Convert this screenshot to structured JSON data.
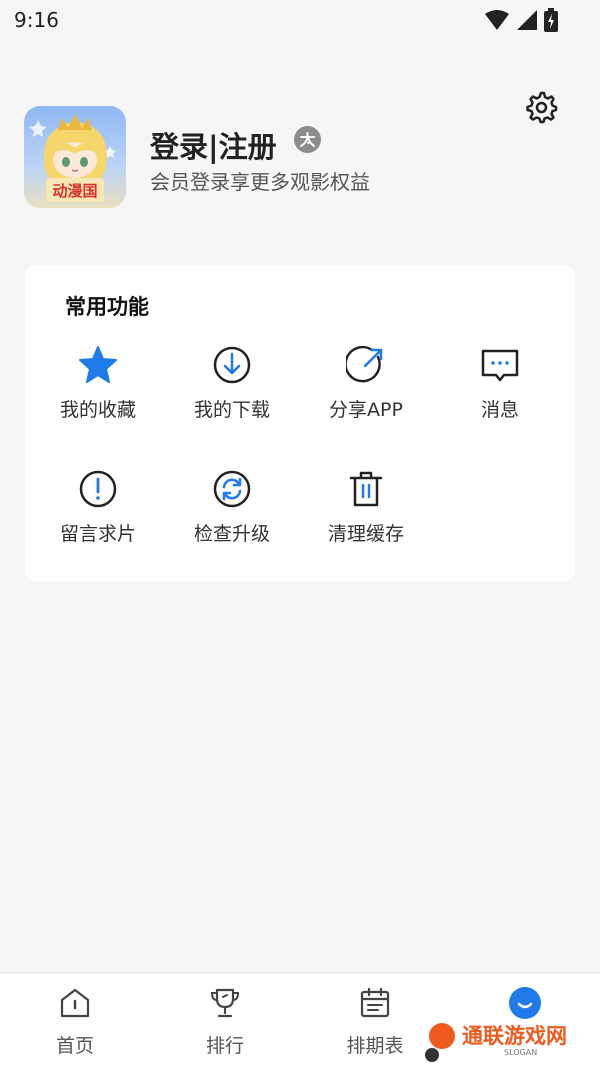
{
  "status_bar": {
    "time": "9:16",
    "icons": [
      "wifi-icon",
      "signal-icon",
      "battery-icon"
    ]
  },
  "profile": {
    "title": "登录|注册",
    "subtitle": "会员登录享更多观影权益",
    "avatar_text": "动漫国",
    "badge_icon": "vip-badge-icon",
    "settings_icon": "gear-icon"
  },
  "functions": {
    "title": "常用功能",
    "items": [
      {
        "label": "我的收藏",
        "icon": "star-icon"
      },
      {
        "label": "我的下载",
        "icon": "download-icon"
      },
      {
        "label": "分享APP",
        "icon": "share-icon"
      },
      {
        "label": "消息",
        "icon": "message-icon"
      },
      {
        "label": "留言求片",
        "icon": "exclamation-icon"
      },
      {
        "label": "检查升级",
        "icon": "refresh-icon"
      },
      {
        "label": "清理缓存",
        "icon": "trash-icon"
      }
    ]
  },
  "bottom_nav": {
    "items": [
      {
        "label": "首页",
        "icon": "home-icon"
      },
      {
        "label": "排行",
        "icon": "trophy-icon"
      },
      {
        "label": "排期表",
        "icon": "calendar-icon"
      },
      {
        "label": "",
        "icon": "profile-icon"
      }
    ]
  },
  "watermark": {
    "text": "通联游戏网",
    "sub": "SLOGAN"
  },
  "colors": {
    "accent": "#1e7be8",
    "background": "#f6f6f6",
    "card": "#ffffff",
    "watermark": "#ee5b1f"
  }
}
